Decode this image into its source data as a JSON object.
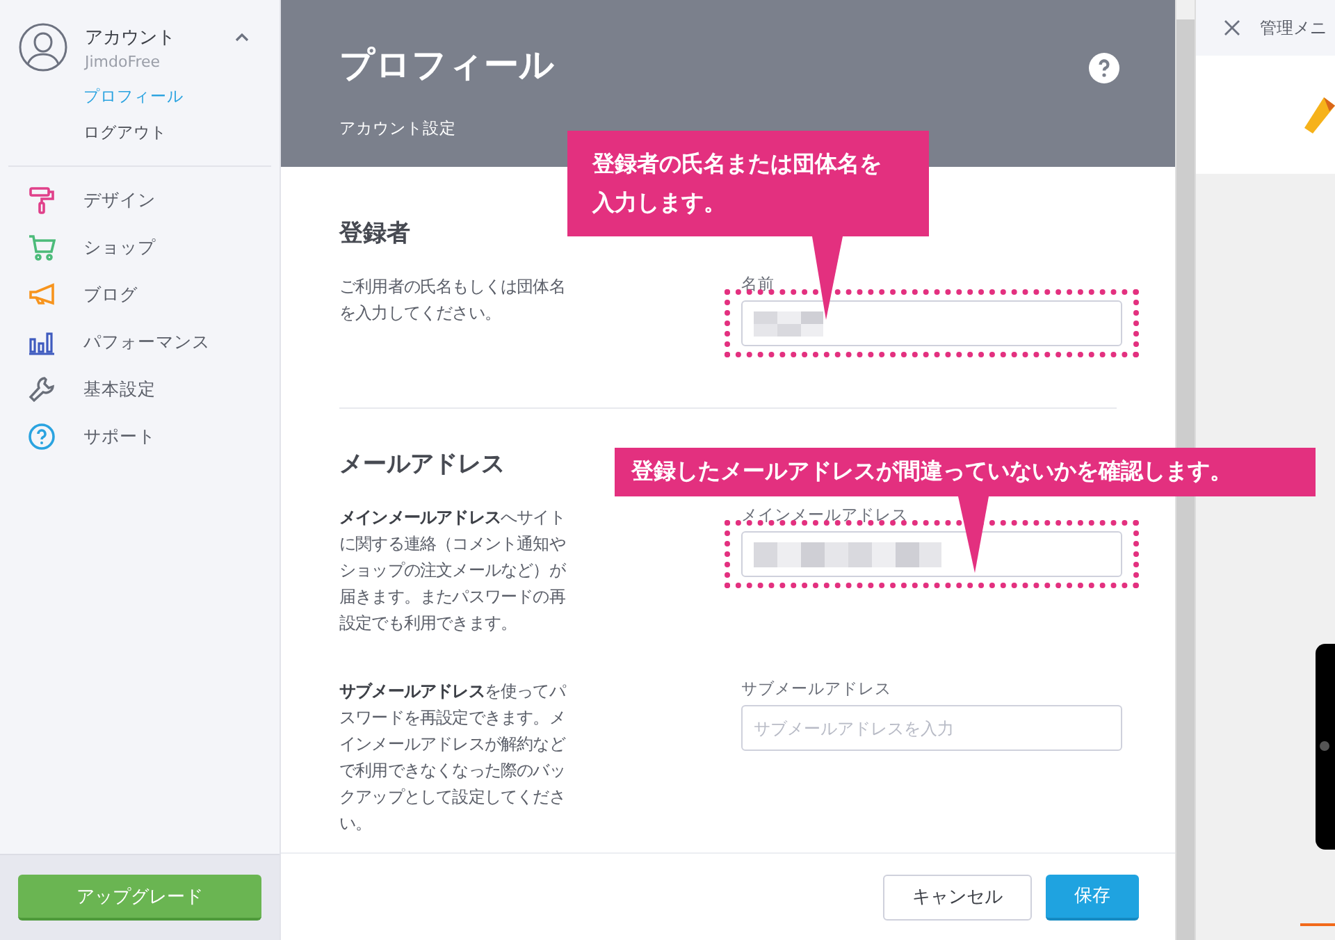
{
  "sidebar": {
    "account": {
      "title": "アカウント",
      "plan": "JimdoFree",
      "expanded": true,
      "items": [
        {
          "label": "プロフィール",
          "selected": true
        },
        {
          "label": "ログアウト",
          "selected": false
        }
      ]
    },
    "menu": [
      {
        "label": "デザイン",
        "kind": "roller",
        "color": "#e0408a"
      },
      {
        "label": "ショップ",
        "kind": "cart",
        "color": "#4cbb7a"
      },
      {
        "label": "ブログ",
        "kind": "megaphone",
        "color": "#f7941d"
      },
      {
        "label": "パフォーマンス",
        "kind": "bars",
        "color": "#3f5bbf"
      },
      {
        "label": "基本設定",
        "kind": "wrench",
        "color": "#6a6f7a"
      },
      {
        "label": "サポート",
        "kind": "help",
        "color": "#2aa3e0"
      }
    ],
    "upgrade_button": "アップグレード"
  },
  "header": {
    "title": "プロフィール",
    "subtitle": "アカウント設定"
  },
  "sections": [
    {
      "heading": "登録者",
      "paragraphs": [
        "ご利用者の氏名もしくは団体名を入力してください。"
      ],
      "fields": [
        {
          "label": "名前",
          "kind": "redacted",
          "highlighted": true
        }
      ]
    },
    {
      "heading": "メールアドレス",
      "paragraphs": [
        "**メインメールアドレス**へサイトに関する連絡（コメント通知やショップの注文メールなど）が届きます。またパスワードの再設定でも利用できます。",
        "**サブメールアドレス**を使ってパスワードを再設定できます。メインメールアドレスが解約などで利用できなくなった際のバックアップとして設定してください。"
      ],
      "fields": [
        {
          "label": "メインメールアドレス",
          "kind": "redacted",
          "highlighted": true
        },
        {
          "label": "サブメールアドレス",
          "kind": "empty",
          "placeholder": "サブメールアドレスを入力",
          "highlighted": false
        }
      ]
    }
  ],
  "footer": {
    "cancel": "キャンセル",
    "save": "保存"
  },
  "callouts": [
    "登録者の氏名または団体名を入力します。",
    "登録したメールアドレスが間違っていないかを確認します。"
  ],
  "right_panel": {
    "title": "管理メニ"
  }
}
